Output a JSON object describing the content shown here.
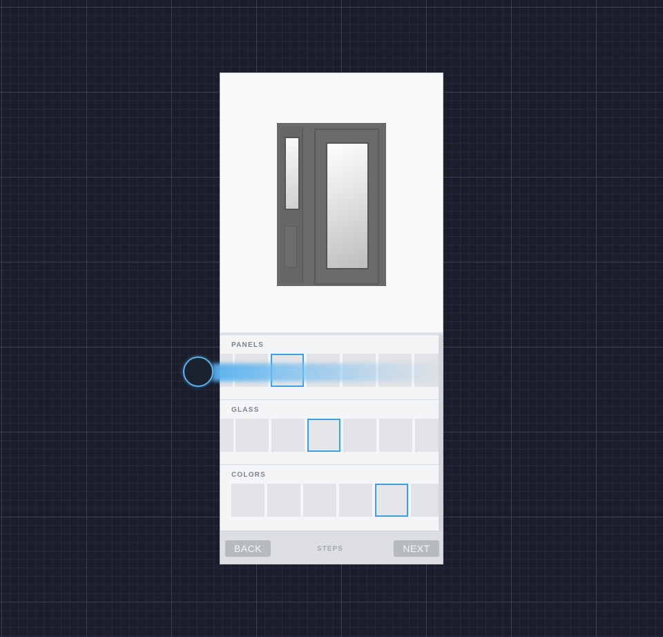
{
  "preview": {
    "image": "door-with-sidelite-image"
  },
  "sections": {
    "panels": {
      "title": "PANELS",
      "selected_index": 2
    },
    "glass": {
      "title": "GLASS",
      "selected_index": 3
    },
    "colors": {
      "title": "COLORS",
      "selected_index": 4
    }
  },
  "footer": {
    "back_label": "BACK",
    "steps_label": "STEPS",
    "next_label": "NEXT"
  },
  "colors": {
    "accent": "#3b9fe6",
    "background": "#1a1e2b"
  }
}
